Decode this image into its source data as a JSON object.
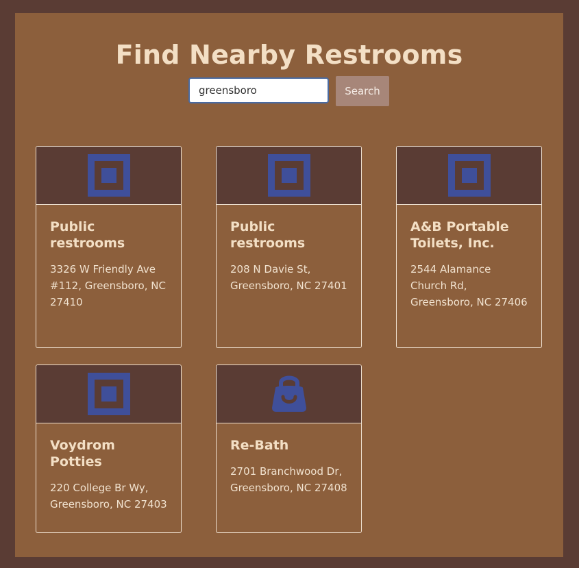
{
  "page": {
    "title": "Find Nearby Restrooms"
  },
  "search": {
    "value": "greensboro",
    "button_label": "Search"
  },
  "results": [
    {
      "name": "Public restrooms",
      "address": "3326 W Friendly Ave #112, Greensboro, NC 27410",
      "icon": "square-icon"
    },
    {
      "name": "Public restrooms",
      "address": "208 N Davie St, Greensboro, NC 27401",
      "icon": "square-icon"
    },
    {
      "name": "A&B Portable Toilets, Inc.",
      "address": "2544 Alamance Church Rd, Greensboro, NC 27406",
      "icon": "square-icon"
    },
    {
      "name": "Voydrom Potties",
      "address": "220 College Br Wy, Greensboro, NC 27403",
      "icon": "square-icon"
    },
    {
      "name": "Re-Bath",
      "address": "2701 Branchwood Dr, Greensboro, NC 27408",
      "icon": "shopping-bag-icon"
    }
  ],
  "colors": {
    "outer_background": "#5a3c34",
    "panel_background": "#8c5f3c",
    "icon_blue": "#3f4f9a",
    "title_text": "#f3dfc5",
    "button_background": "#a78679",
    "card_border": "#f0e2d2"
  }
}
